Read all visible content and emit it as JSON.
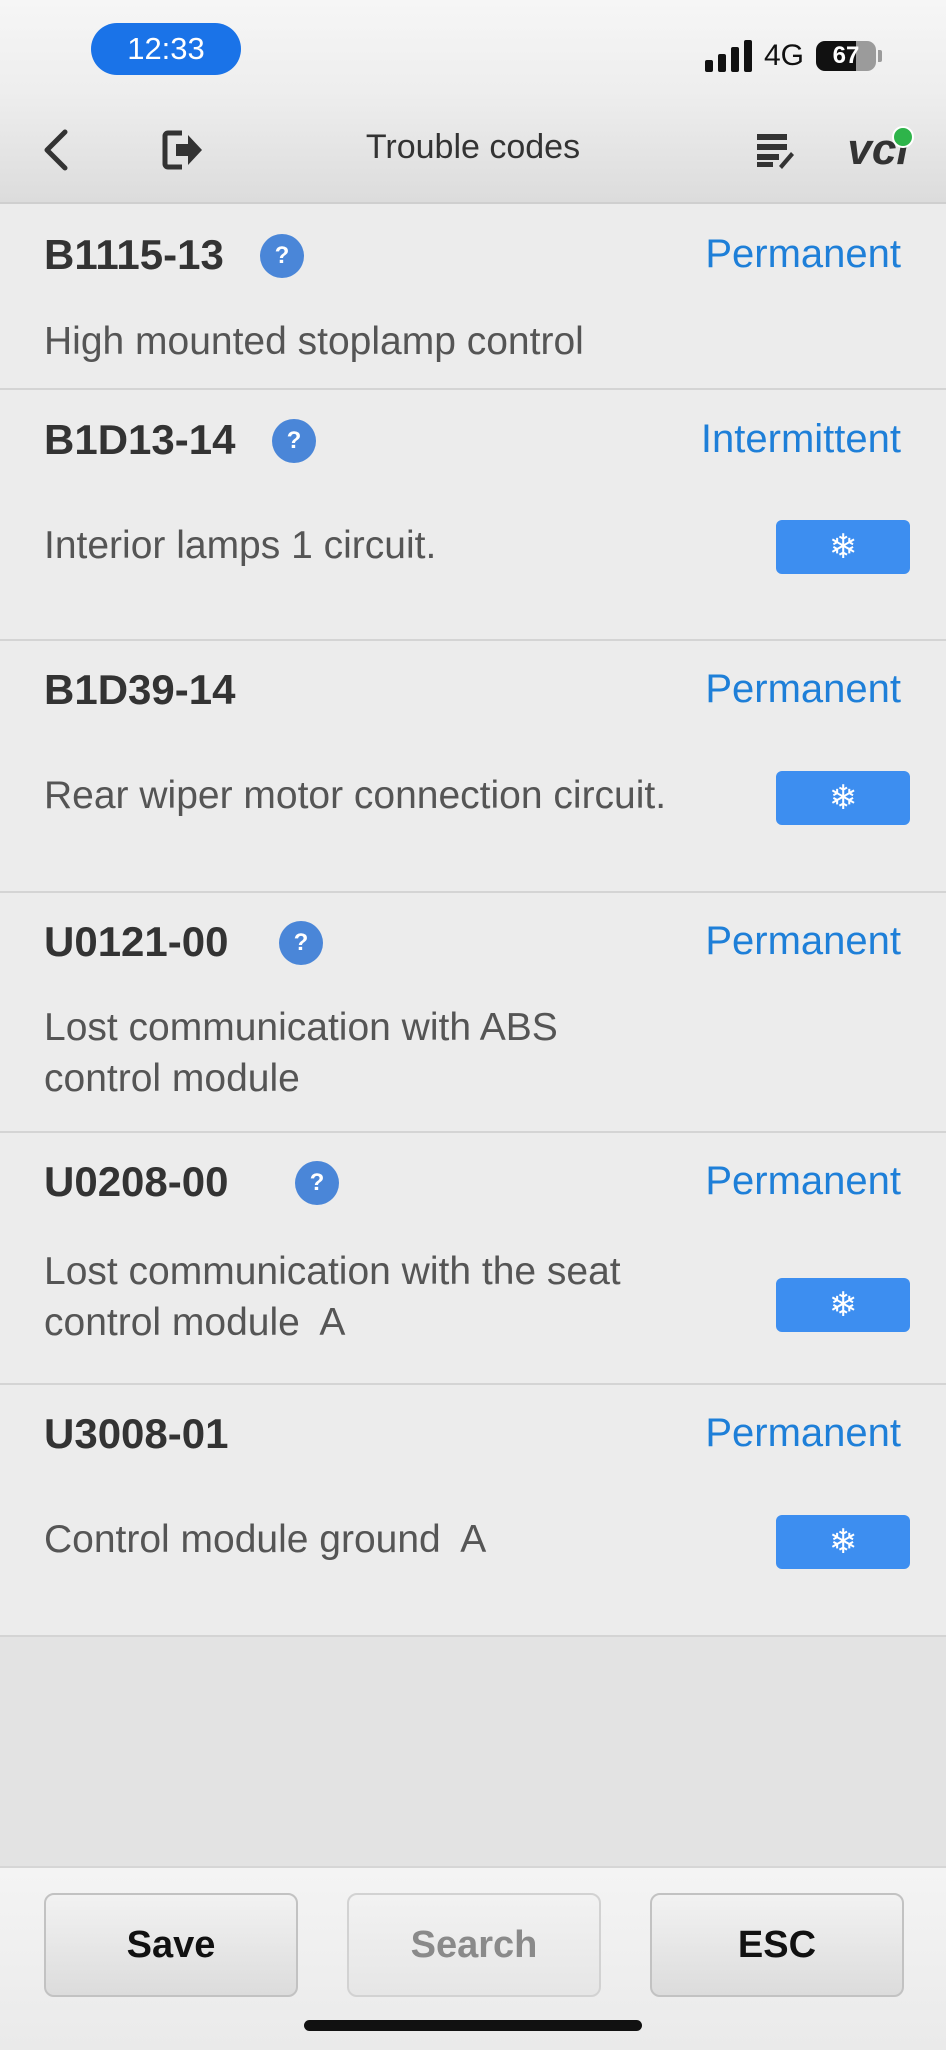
{
  "status_bar": {
    "time": "12:33",
    "network": "4G",
    "battery": "67"
  },
  "header": {
    "title": "Trouble codes",
    "vci_label": "vci"
  },
  "codes": [
    {
      "code": "B1115-13",
      "help": "?",
      "status": "Permanent",
      "description": "High mounted stoplamp control"
    },
    {
      "code": "B1D13-14",
      "help": "?",
      "status": "Intermittent",
      "description": "Interior lamps 1 circuit.",
      "freeze": "❄"
    },
    {
      "code": "B1D39-14",
      "status": "Permanent",
      "description": "Rear wiper motor connection circuit.",
      "freeze": "❄"
    },
    {
      "code": "U0121-00",
      "help": "?",
      "status": "Permanent",
      "description": "Lost communication with ABS control module"
    },
    {
      "code": "U0208-00",
      "help": "?",
      "status": "Permanent",
      "description": "Lost communication with the seat control module  A",
      "freeze": "❄"
    },
    {
      "code": "U3008-01",
      "status": "Permanent",
      "description": "Control module ground  A",
      "freeze": "❄"
    }
  ],
  "footer": {
    "save": "Save",
    "search": "Search",
    "esc": "ESC"
  }
}
